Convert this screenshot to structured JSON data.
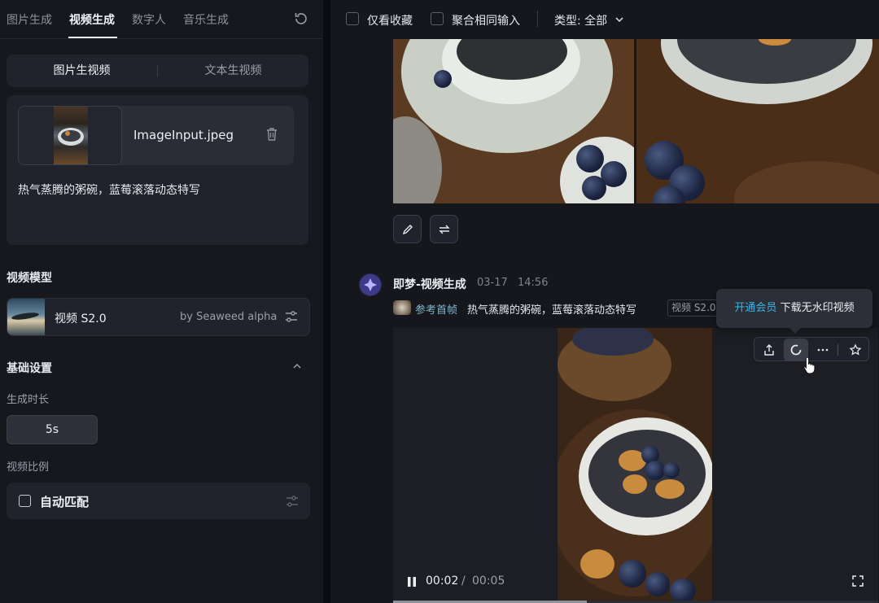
{
  "top_tabs": [
    "图片生成",
    "视频生成",
    "数字人",
    "音乐生成"
  ],
  "mode": {
    "image_to_video": "图片生视频",
    "text_to_video": "文本生视频"
  },
  "input": {
    "file_name": "ImageInput.jpeg",
    "prompt": "热气蒸腾的粥碗，蓝莓滚落动态特写"
  },
  "model_section": {
    "title": "视频模型",
    "name": "视频 S2.0",
    "by": "by Seaweed alpha"
  },
  "basic_settings": {
    "title": "基础设置",
    "duration_label": "生成时长",
    "duration_value": "5s",
    "ratio_label": "视频比例",
    "ratio_value": "自动匹配"
  },
  "filters": {
    "favorites_only": "仅看收藏",
    "merge_same_input": "聚合相同输入",
    "type_select": "类型: 全部"
  },
  "generation": {
    "title": "即梦-视频生成",
    "date": "03-17",
    "time": "14:56",
    "ref_label": "参考首帧",
    "prompt": "热气蒸腾的粥碗，蓝莓滚落动态特写",
    "model_tag": "视频 S2.0"
  },
  "tooltip": {
    "link": "开通会员",
    "text": "下载无水印视频"
  },
  "player": {
    "current": "00:02",
    "separator": "/",
    "total": "00:05",
    "progress": 0.4
  },
  "icons": [
    "refresh-icon",
    "trash-icon",
    "settings-icon",
    "chevron-up-icon",
    "chevron-down-icon",
    "edit-icon",
    "regenerate-icon",
    "share-icon",
    "loading-icon",
    "more-icon",
    "star-icon",
    "pause-icon",
    "fullscreen-icon"
  ],
  "colors": {
    "accent_link": "#35b6e6",
    "background": "#0f1117",
    "panel": "#16181e",
    "ref_label": "#7fb5c8"
  }
}
